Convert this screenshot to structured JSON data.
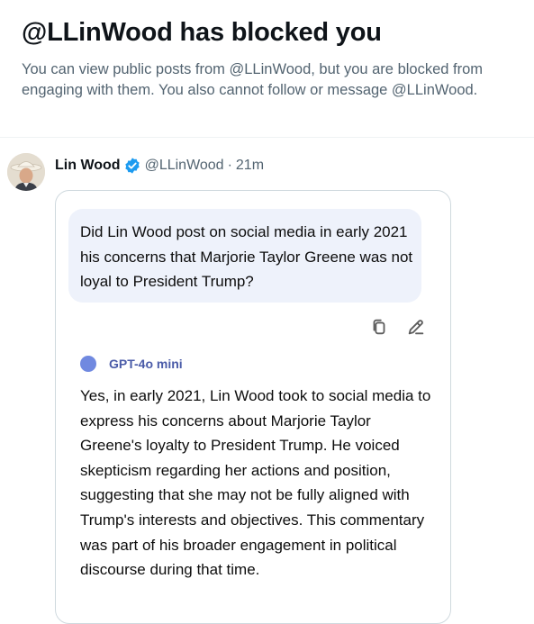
{
  "block_notice": {
    "title": "@LLinWood has blocked you",
    "description": "You can view public posts from @LLinWood, but you are blocked from engaging with them. You also cannot follow or message @LLinWood."
  },
  "post": {
    "author_name": "Lin Wood",
    "verified": true,
    "handle": "@LLinWood",
    "separator": "·",
    "time": "21m",
    "embedded_chat": {
      "user_message": "Did Lin Wood post on social media in early 2021 his concerns that Marjorie Taylor Greene was not loyal to President Trump?",
      "actions": [
        "copy-icon",
        "edit-icon"
      ],
      "model_name": "GPT-4o mini",
      "model_response": "Yes, in early 2021, Lin Wood took to social media to express his concerns about Marjorie Taylor Greene's loyalty to President Trump. He voiced skepticism regarding her actions and position, suggesting that she may not be fully aligned with Trump's interests and objectives. This commentary was part of his broader engagement in political discourse during that time."
    }
  },
  "colors": {
    "verified_badge": "#1d9bf0",
    "chat_bubble": "#eef2fb",
    "model_dot": "#7089e0",
    "secondary_text": "#536471"
  }
}
